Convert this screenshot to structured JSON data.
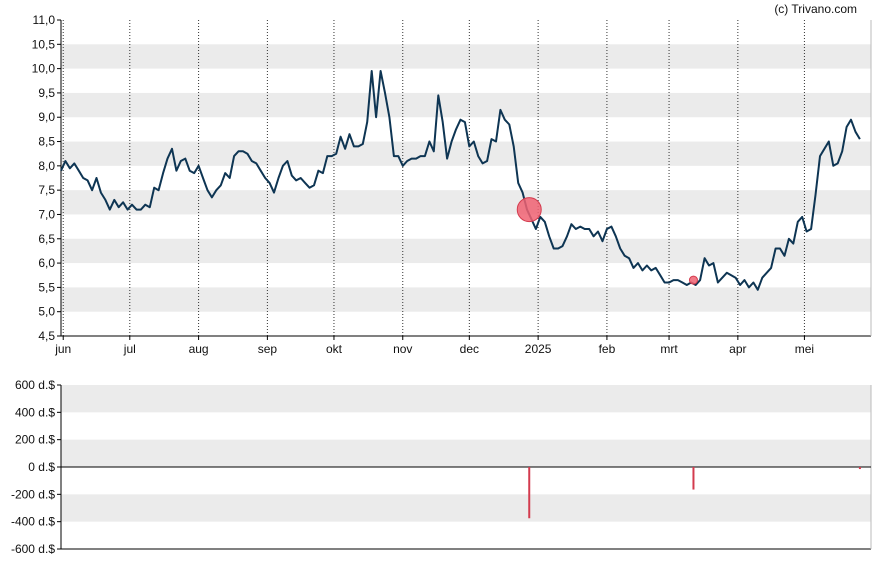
{
  "credit": "(c) Trivano.com",
  "colors": {
    "line": "#0e3553",
    "band": "#ebebeb",
    "marker": "#f06272",
    "marker_edge": "#d33b4e",
    "bar": "#d33b4e",
    "axis": "#000000"
  },
  "chart_data": [
    {
      "type": "line",
      "name": "price",
      "ylim": [
        4.5,
        11.0
      ],
      "yticks": [
        "11,0",
        "10,5",
        "10,0",
        "9,5",
        "9,0",
        "8,5",
        "8,0",
        "7,5",
        "7,0",
        "6,5",
        "6,0",
        "5,5",
        "5,0",
        "4,5"
      ],
      "x_start": "2024-05-31",
      "x_end": "2025-05-31",
      "xticks": [
        {
          "label": "jun",
          "date": "2024-06-01"
        },
        {
          "label": "jul",
          "date": "2024-07-01"
        },
        {
          "label": "aug",
          "date": "2024-08-01"
        },
        {
          "label": "sep",
          "date": "2024-09-01"
        },
        {
          "label": "okt",
          "date": "2024-10-01"
        },
        {
          "label": "nov",
          "date": "2024-11-01"
        },
        {
          "label": "dec",
          "date": "2024-12-01"
        },
        {
          "label": "2025",
          "date": "2025-01-01"
        },
        {
          "label": "feb",
          "date": "2025-02-01"
        },
        {
          "label": "mrt",
          "date": "2025-03-01"
        },
        {
          "label": "apr",
          "date": "2025-04-01"
        },
        {
          "label": "mei",
          "date": "2025-05-01"
        }
      ],
      "grid": "vertical dotted at month starts, horizontal alternating bands",
      "series": [
        {
          "points": [
            [
              "2024-05-31",
              7.9
            ],
            [
              "2024-06-02",
              8.1
            ],
            [
              "2024-06-04",
              7.95
            ],
            [
              "2024-06-06",
              8.05
            ],
            [
              "2024-06-08",
              7.9
            ],
            [
              "2024-06-10",
              7.75
            ],
            [
              "2024-06-12",
              7.7
            ],
            [
              "2024-06-14",
              7.5
            ],
            [
              "2024-06-16",
              7.75
            ],
            [
              "2024-06-18",
              7.45
            ],
            [
              "2024-06-20",
              7.3
            ],
            [
              "2024-06-22",
              7.1
            ],
            [
              "2024-06-24",
              7.3
            ],
            [
              "2024-06-26",
              7.15
            ],
            [
              "2024-06-28",
              7.25
            ],
            [
              "2024-06-30",
              7.1
            ],
            [
              "2024-07-02",
              7.2
            ],
            [
              "2024-07-04",
              7.1
            ],
            [
              "2024-07-06",
              7.1
            ],
            [
              "2024-07-08",
              7.2
            ],
            [
              "2024-07-10",
              7.15
            ],
            [
              "2024-07-12",
              7.55
            ],
            [
              "2024-07-14",
              7.5
            ],
            [
              "2024-07-16",
              7.85
            ],
            [
              "2024-07-18",
              8.15
            ],
            [
              "2024-07-20",
              8.35
            ],
            [
              "2024-07-22",
              7.9
            ],
            [
              "2024-07-24",
              8.1
            ],
            [
              "2024-07-26",
              8.15
            ],
            [
              "2024-07-28",
              7.9
            ],
            [
              "2024-07-30",
              7.85
            ],
            [
              "2024-08-01",
              8.0
            ],
            [
              "2024-08-03",
              7.75
            ],
            [
              "2024-08-05",
              7.5
            ],
            [
              "2024-08-07",
              7.35
            ],
            [
              "2024-08-09",
              7.5
            ],
            [
              "2024-08-11",
              7.6
            ],
            [
              "2024-08-13",
              7.85
            ],
            [
              "2024-08-15",
              7.75
            ],
            [
              "2024-08-17",
              8.2
            ],
            [
              "2024-08-19",
              8.3
            ],
            [
              "2024-08-21",
              8.3
            ],
            [
              "2024-08-23",
              8.25
            ],
            [
              "2024-08-25",
              8.1
            ],
            [
              "2024-08-27",
              8.05
            ],
            [
              "2024-08-29",
              7.9
            ],
            [
              "2024-08-31",
              7.75
            ],
            [
              "2024-09-02",
              7.65
            ],
            [
              "2024-09-04",
              7.45
            ],
            [
              "2024-09-06",
              7.75
            ],
            [
              "2024-09-08",
              8.0
            ],
            [
              "2024-09-10",
              8.1
            ],
            [
              "2024-09-12",
              7.8
            ],
            [
              "2024-09-14",
              7.7
            ],
            [
              "2024-09-16",
              7.75
            ],
            [
              "2024-09-18",
              7.65
            ],
            [
              "2024-09-20",
              7.55
            ],
            [
              "2024-09-22",
              7.6
            ],
            [
              "2024-09-24",
              7.9
            ],
            [
              "2024-09-26",
              7.85
            ],
            [
              "2024-09-28",
              8.2
            ],
            [
              "2024-09-30",
              8.2
            ],
            [
              "2024-10-02",
              8.25
            ],
            [
              "2024-10-04",
              8.6
            ],
            [
              "2024-10-06",
              8.35
            ],
            [
              "2024-10-08",
              8.65
            ],
            [
              "2024-10-10",
              8.4
            ],
            [
              "2024-10-12",
              8.4
            ],
            [
              "2024-10-14",
              8.45
            ],
            [
              "2024-10-16",
              8.9
            ],
            [
              "2024-10-18",
              9.95
            ],
            [
              "2024-10-20",
              9.0
            ],
            [
              "2024-10-22",
              9.95
            ],
            [
              "2024-10-24",
              9.5
            ],
            [
              "2024-10-26",
              9.0
            ],
            [
              "2024-10-28",
              8.2
            ],
            [
              "2024-10-30",
              8.2
            ],
            [
              "2024-11-01",
              8.0
            ],
            [
              "2024-11-03",
              8.1
            ],
            [
              "2024-11-05",
              8.15
            ],
            [
              "2024-11-07",
              8.15
            ],
            [
              "2024-11-09",
              8.2
            ],
            [
              "2024-11-11",
              8.2
            ],
            [
              "2024-11-13",
              8.5
            ],
            [
              "2024-11-15",
              8.3
            ],
            [
              "2024-11-17",
              9.45
            ],
            [
              "2024-11-19",
              8.9
            ],
            [
              "2024-11-21",
              8.15
            ],
            [
              "2024-11-23",
              8.5
            ],
            [
              "2024-11-25",
              8.75
            ],
            [
              "2024-11-27",
              8.95
            ],
            [
              "2024-11-29",
              8.9
            ],
            [
              "2024-12-01",
              8.4
            ],
            [
              "2024-12-03",
              8.5
            ],
            [
              "2024-12-05",
              8.2
            ],
            [
              "2024-12-07",
              8.05
            ],
            [
              "2024-12-09",
              8.1
            ],
            [
              "2024-12-11",
              8.55
            ],
            [
              "2024-12-13",
              8.5
            ],
            [
              "2024-12-15",
              9.15
            ],
            [
              "2024-12-17",
              8.95
            ],
            [
              "2024-12-19",
              8.85
            ],
            [
              "2024-12-21",
              8.4
            ],
            [
              "2024-12-23",
              7.65
            ],
            [
              "2024-12-25",
              7.45
            ],
            [
              "2024-12-27",
              7.1
            ],
            [
              "2024-12-29",
              6.9
            ],
            [
              "2024-12-31",
              6.7
            ],
            [
              "2025-01-02",
              6.95
            ],
            [
              "2025-01-04",
              6.85
            ],
            [
              "2025-01-06",
              6.55
            ],
            [
              "2025-01-08",
              6.3
            ],
            [
              "2025-01-10",
              6.3
            ],
            [
              "2025-01-12",
              6.35
            ],
            [
              "2025-01-14",
              6.55
            ],
            [
              "2025-01-16",
              6.8
            ],
            [
              "2025-01-18",
              6.7
            ],
            [
              "2025-01-20",
              6.75
            ],
            [
              "2025-01-22",
              6.7
            ],
            [
              "2025-01-24",
              6.7
            ],
            [
              "2025-01-26",
              6.55
            ],
            [
              "2025-01-28",
              6.65
            ],
            [
              "2025-01-30",
              6.45
            ],
            [
              "2025-02-01",
              6.7
            ],
            [
              "2025-02-03",
              6.75
            ],
            [
              "2025-02-05",
              6.55
            ],
            [
              "2025-02-07",
              6.3
            ],
            [
              "2025-02-09",
              6.15
            ],
            [
              "2025-02-11",
              6.1
            ],
            [
              "2025-02-13",
              5.9
            ],
            [
              "2025-02-15",
              6.0
            ],
            [
              "2025-02-17",
              5.85
            ],
            [
              "2025-02-19",
              5.95
            ],
            [
              "2025-02-21",
              5.85
            ],
            [
              "2025-02-23",
              5.9
            ],
            [
              "2025-02-25",
              5.75
            ],
            [
              "2025-02-27",
              5.6
            ],
            [
              "2025-03-01",
              5.6
            ],
            [
              "2025-03-03",
              5.65
            ],
            [
              "2025-03-05",
              5.65
            ],
            [
              "2025-03-07",
              5.6
            ],
            [
              "2025-03-09",
              5.55
            ],
            [
              "2025-03-11",
              5.6
            ],
            [
              "2025-03-13",
              5.55
            ],
            [
              "2025-03-15",
              5.65
            ],
            [
              "2025-03-17",
              6.1
            ],
            [
              "2025-03-19",
              5.95
            ],
            [
              "2025-03-21",
              6.0
            ],
            [
              "2025-03-23",
              5.6
            ],
            [
              "2025-03-25",
              5.7
            ],
            [
              "2025-03-27",
              5.8
            ],
            [
              "2025-03-29",
              5.75
            ],
            [
              "2025-03-31",
              5.7
            ],
            [
              "2025-04-02",
              5.55
            ],
            [
              "2025-04-04",
              5.65
            ],
            [
              "2025-04-06",
              5.5
            ],
            [
              "2025-04-08",
              5.6
            ],
            [
              "2025-04-10",
              5.45
            ],
            [
              "2025-04-12",
              5.7
            ],
            [
              "2025-04-14",
              5.8
            ],
            [
              "2025-04-16",
              5.9
            ],
            [
              "2025-04-18",
              6.3
            ],
            [
              "2025-04-20",
              6.3
            ],
            [
              "2025-04-22",
              6.15
            ],
            [
              "2025-04-24",
              6.5
            ],
            [
              "2025-04-26",
              6.4
            ],
            [
              "2025-04-28",
              6.85
            ],
            [
              "2025-04-30",
              6.95
            ],
            [
              "2025-05-02",
              6.65
            ],
            [
              "2025-05-04",
              6.7
            ],
            [
              "2025-05-06",
              7.4
            ],
            [
              "2025-05-08",
              8.2
            ],
            [
              "2025-05-10",
              8.35
            ],
            [
              "2025-05-12",
              8.5
            ],
            [
              "2025-05-14",
              8.0
            ],
            [
              "2025-05-16",
              8.05
            ],
            [
              "2025-05-18",
              8.3
            ],
            [
              "2025-05-20",
              8.8
            ],
            [
              "2025-05-22",
              8.95
            ],
            [
              "2025-05-24",
              8.7
            ],
            [
              "2025-05-26",
              8.55
            ]
          ]
        }
      ],
      "markers": [
        {
          "date": "2024-12-28",
          "value": 7.1,
          "size": "large"
        },
        {
          "date": "2025-03-12",
          "value": 5.65,
          "size": "small"
        }
      ]
    },
    {
      "type": "bar",
      "name": "transactions",
      "ylim": [
        -600,
        600
      ],
      "yticks": [
        "600 d.$",
        "400 d.$",
        "200 d.$",
        "0 d.$",
        "-200 d.$",
        "-400 d.$",
        "-600 d.$"
      ],
      "bars": [
        {
          "date": "2024-12-28",
          "value": -375
        },
        {
          "date": "2025-03-12",
          "value": -165
        },
        {
          "date": "2025-05-26",
          "value": -15
        }
      ]
    }
  ]
}
